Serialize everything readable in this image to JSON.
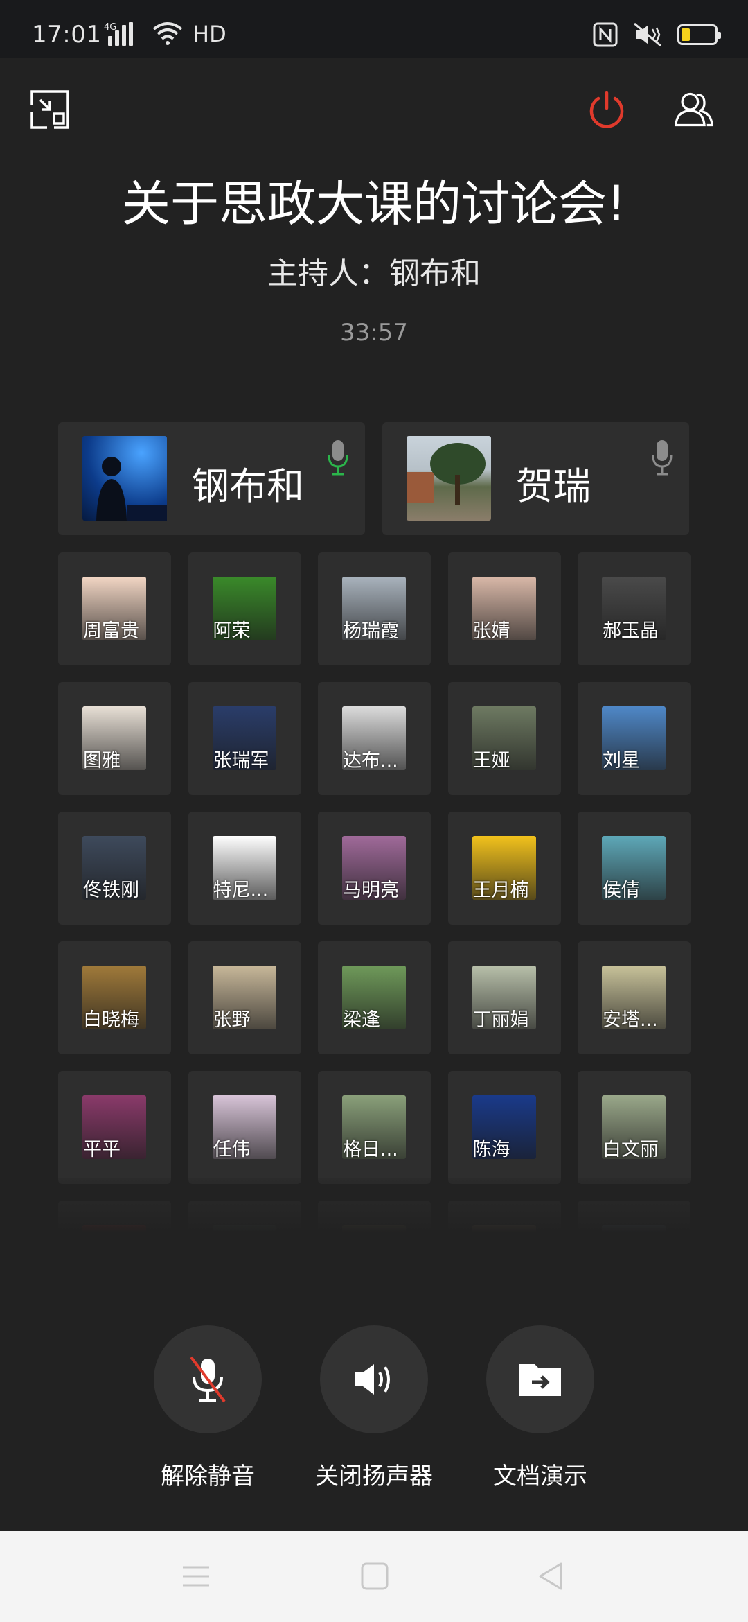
{
  "status_bar": {
    "time": "17:01",
    "network": "4G",
    "hd": "HD",
    "battery_level": 0.25,
    "battery_color": "#f5d21c"
  },
  "header": {
    "title": "关于思政大课的讨论会!",
    "host": "主持人：钢布和",
    "timer": "33:57",
    "icons": [
      "minimize-icon",
      "power-icon",
      "participants-icon"
    ],
    "power_color": "#e03a2c"
  },
  "speakers": [
    {
      "name": "钢布和",
      "mic_active": true,
      "mic_color": "#2bb54b"
    },
    {
      "name": "贺瑞",
      "mic_active": false,
      "mic_color": "#8c8c8c"
    }
  ],
  "participants": [
    {
      "name": "周富贵",
      "bg": "#f2d6c4"
    },
    {
      "name": "阿荣",
      "bg": "#3a8a2a"
    },
    {
      "name": "杨瑞霞",
      "bg": "#a9b3bd"
    },
    {
      "name": "张婧",
      "bg": "#d9b8a8"
    },
    {
      "name": "郝玉晶",
      "bg": "#4a4a4a"
    },
    {
      "name": "图雅",
      "bg": "#e8e0d6"
    },
    {
      "name": "张瑞军",
      "bg": "#2a3d6a"
    },
    {
      "name": "达布...",
      "bg": "#dcdcdc"
    },
    {
      "name": "王娅",
      "bg": "#6e7a62"
    },
    {
      "name": "刘星",
      "bg": "#4f88c8"
    },
    {
      "name": "佟铁刚",
      "bg": "#3e4a5c"
    },
    {
      "name": "特尼...",
      "bg": "#ffffff"
    },
    {
      "name": "马明亮",
      "bg": "#a06a9a"
    },
    {
      "name": "王月楠",
      "bg": "#f2c21c"
    },
    {
      "name": "侯倩",
      "bg": "#5ea8b8"
    },
    {
      "name": "白晓梅",
      "bg": "#a07a3a"
    },
    {
      "name": "张野",
      "bg": "#c8b89a"
    },
    {
      "name": "梁逢",
      "bg": "#6f9a5a"
    },
    {
      "name": "丁丽娟",
      "bg": "#b8c0aa"
    },
    {
      "name": "安塔...",
      "bg": "#c8c29a"
    },
    {
      "name": "平平",
      "bg": "#8a3a6a"
    },
    {
      "name": "任伟",
      "bg": "#d8c4d8"
    },
    {
      "name": "格日...",
      "bg": "#8aa07a"
    },
    {
      "name": "陈海",
      "bg": "#1a3a8a"
    },
    {
      "name": "白文丽",
      "bg": "#9aa88a"
    }
  ],
  "controls": [
    {
      "label": "解除静音",
      "icon": "mic-muted-icon"
    },
    {
      "label": "关闭扬声器",
      "icon": "speaker-icon"
    },
    {
      "label": "文档演示",
      "icon": "folder-share-icon"
    }
  ],
  "nav_bar": {
    "icons": [
      "menu-icon",
      "home-icon",
      "back-icon"
    ]
  }
}
